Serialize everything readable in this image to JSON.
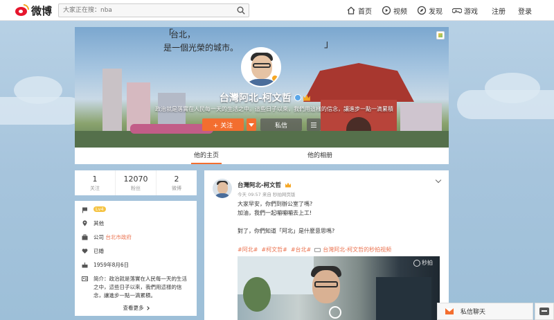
{
  "brand": {
    "name": "微博"
  },
  "search": {
    "placeholder": "大家正在搜：nba"
  },
  "nav": {
    "items": [
      {
        "label": "首页",
        "icon": "home-icon"
      },
      {
        "label": "视频",
        "icon": "video-icon"
      },
      {
        "label": "发现",
        "icon": "discover-icon"
      },
      {
        "label": "游戏",
        "icon": "game-icon"
      }
    ],
    "register": "注册",
    "login": "登录"
  },
  "profile": {
    "cover_line1": "台北，",
    "cover_line2": "是一個光榮的城市。",
    "cover_quote_open": "「",
    "cover_quote_close": "」",
    "name": "台灣阿北-柯文哲",
    "description": "政治就是落實在人民每一天的生活之中。這些日子以來，我們用這樣的信念，讓進步一點一滴累積",
    "follow_label": "+ 关注",
    "message_label": "私信"
  },
  "tabs": [
    {
      "label": "他的主页",
      "active": true
    },
    {
      "label": "他的相册",
      "active": false
    }
  ],
  "stats": [
    {
      "num": "1",
      "label": "关注"
    },
    {
      "num": "12070",
      "label": "粉丝"
    },
    {
      "num": "2",
      "label": "微博"
    }
  ],
  "info": {
    "level": "Lv4",
    "location": "其他",
    "company_prefix": "公司",
    "company": "台北市政府",
    "marital": "已婚",
    "birthday": "1959年8月6日",
    "bio_label": "简介：",
    "bio": "政治就是落實在人民每一天的生活之中，這些日子以來，我們用這樣的信念，讓進步一點一滴累積。",
    "more": "查看更多"
  },
  "post": {
    "author": "台灣阿北-柯文哲",
    "meta": "今天 09:57 来自 秒拍网页版",
    "line1": "大家早安，你們到辦公室了嗎?",
    "line2": "加油，我們一起嘣嘣嘣去上工!",
    "line3": "對了，你們知道「阿北」是什麼意思嗎?",
    "tags": [
      "#阿北#",
      "#柯文哲#",
      "#台北#"
    ],
    "video_link": "台灣阿北-柯文哲的秒拍视频",
    "watermark": "秒拍"
  },
  "chat": {
    "label": "私信聊天"
  },
  "colors": {
    "accent": "#f36e2f",
    "link": "#eb7350",
    "brand_red": "#e6162d"
  }
}
